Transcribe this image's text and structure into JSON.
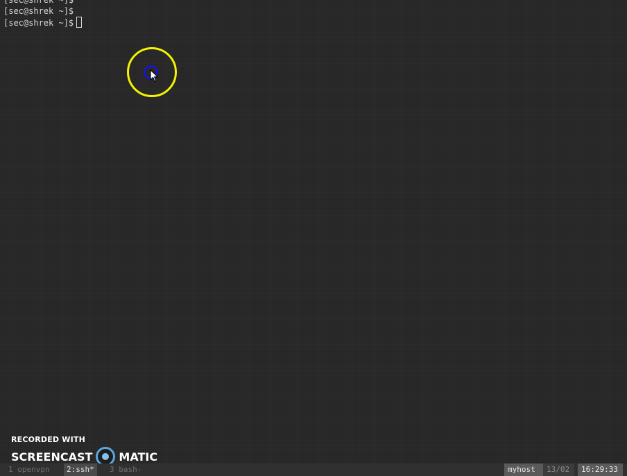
{
  "terminal": {
    "lines": [
      "[sec@shrek ~]$",
      "[sec@shrek ~]$",
      "[sec@shrek ~]$"
    ]
  },
  "watermark": {
    "line1": "RECORDED WITH",
    "brand_left": "SCREENCAST",
    "brand_right": "MATIC"
  },
  "tmux": {
    "windows": [
      {
        "label": "1 openvpn",
        "active": false
      },
      {
        "label": "2:ssh*",
        "active": true
      },
      {
        "label": "3 bash-",
        "active": false
      }
    ],
    "hostname": "myhost",
    "date": "13/02",
    "time": "16:29:33"
  },
  "colors": {
    "background": "#262626",
    "text": "#d6d6d6",
    "highlight_ring": "#f4f400",
    "click_dot": "#1a16c8"
  }
}
